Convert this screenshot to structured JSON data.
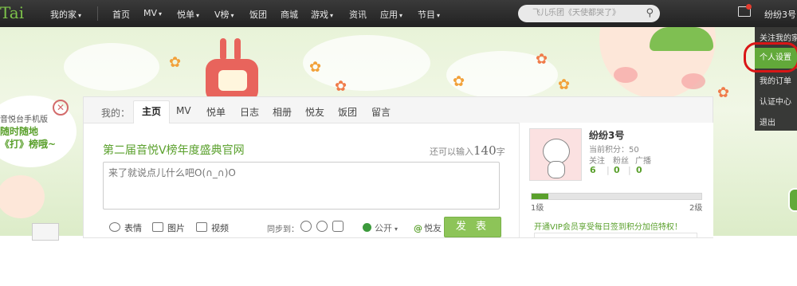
{
  "header": {
    "logo": "Tai",
    "nav": [
      {
        "label": "我的家",
        "dropdown": true
      },
      {
        "label": "首页",
        "dropdown": false
      },
      {
        "label": "MV",
        "dropdown": true
      },
      {
        "label": "悦单",
        "dropdown": true
      },
      {
        "label": "V榜",
        "dropdown": true
      },
      {
        "label": "饭团",
        "dropdown": false
      },
      {
        "label": "商城",
        "dropdown": false
      },
      {
        "label": "游戏",
        "dropdown": true
      },
      {
        "label": "资讯",
        "dropdown": false
      },
      {
        "label": "应用",
        "dropdown": true
      },
      {
        "label": "节目",
        "dropdown": true
      }
    ],
    "search": {
      "placeholder": "飞儿乐团《天使都哭了》",
      "icon": "search-icon"
    },
    "mail_icon": "envelope-icon",
    "username": "纷纷3号",
    "caret": "▾"
  },
  "user_menu": {
    "items": [
      "关注我的家",
      "个人设置",
      "我的订单",
      "认证中心",
      "退出"
    ],
    "active_index": 1,
    "active_color": "#62a93a"
  },
  "promo": {
    "lines": [
      "音悦台手机版",
      "随时随地",
      "《打》榜哦~"
    ],
    "close_icon": "close-circle-icon"
  },
  "profile_tabs": {
    "label": "我的：",
    "items": [
      "主页",
      "MV",
      "悦单",
      "日志",
      "相册",
      "悦友",
      "饭团",
      "留言"
    ],
    "active_index": 0
  },
  "post": {
    "title": "第二届音悦V榜年度盛典官网",
    "char_hint_prefix": "还可以输入",
    "char_count": "140",
    "char_hint_suffix": "字",
    "placeholder": "来了就说点儿什么吧O(∩_∩)O",
    "tools": [
      {
        "label": "表情",
        "icon": "smile-icon"
      },
      {
        "label": "图片",
        "icon": "image-icon"
      },
      {
        "label": "视频",
        "icon": "video-icon"
      }
    ],
    "sync_label": "同步到：",
    "sync_icons": [
      "weibo-icon",
      "renren-icon",
      "qzone-icon"
    ],
    "visibility": "公开",
    "friends_label": "悦友",
    "friends_icon": "at-icon",
    "submit_label": "发 表",
    "accent": "#5aa02c"
  },
  "user_card": {
    "name": "纷纷3号",
    "points_label": "当前积分：",
    "points": "50",
    "stats": [
      {
        "label": "关注",
        "value": "6"
      },
      {
        "label": "粉丝",
        "value": "0"
      },
      {
        "label": "广播",
        "value": "0"
      }
    ],
    "level_from": "1级",
    "level_to": "2级",
    "level_progress": 0.1,
    "vip_text": "开通VIP会员享受每日签到积分加倍特权！"
  }
}
